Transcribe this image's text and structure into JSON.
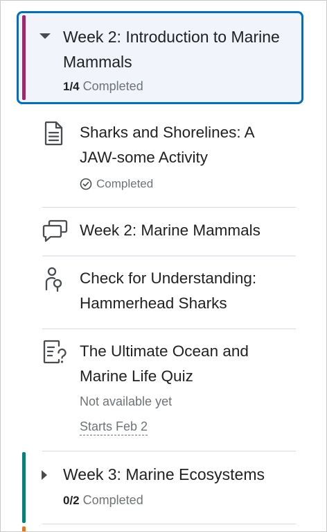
{
  "units": [
    {
      "title": "Week 2: Introduction to Marine Mammals",
      "progress_count": "1/4",
      "progress_label": "Completed",
      "expanded": true,
      "accent_color": "#a3256f",
      "topics": [
        {
          "title": "Sharks and Shorelines: A JAW-some Activity",
          "icon": "document-icon",
          "status": "Completed"
        },
        {
          "title": "Week 2: Marine Mammals",
          "icon": "discussion-icon"
        },
        {
          "title": "Check for Understanding: Hammerhead Sharks",
          "icon": "checkpoint-icon"
        },
        {
          "title": "The Ultimate Ocean and Marine Life Quiz",
          "icon": "quiz-icon",
          "status": "Not available yet",
          "start_date": "Starts Feb 2"
        }
      ]
    },
    {
      "title": "Week 3: Marine Ecosystems",
      "progress_count": "0/2",
      "progress_label": "Completed",
      "expanded": false,
      "accent_color": "#008477"
    },
    {
      "accent_color": "#e87511"
    }
  ],
  "colors": {
    "focus_border": "#006fbf",
    "selected_background": "#f1f5fb",
    "text": "#202122",
    "secondary_text": "#6e7376"
  }
}
